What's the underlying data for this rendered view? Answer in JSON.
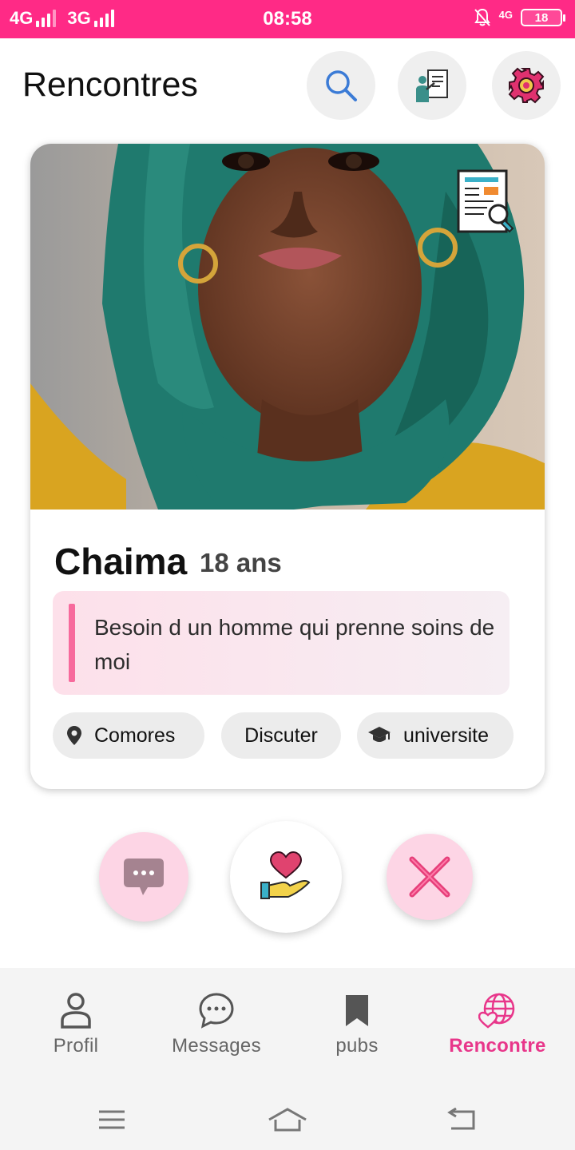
{
  "status_bar": {
    "network1": "4G",
    "network2": "3G",
    "time": "08:58",
    "network3": "4G",
    "battery": "18"
  },
  "header": {
    "title": "Rencontres",
    "icons": [
      "search-icon",
      "teacher-board-icon",
      "settings-gear-icon"
    ]
  },
  "profile_card": {
    "name": "Chaima",
    "age": "18 ans",
    "bio": "Besoin d un homme qui prenne soins de moi",
    "chips": {
      "location": "Comores",
      "intent": "Discuter",
      "education": "universite"
    },
    "photo_icon": "document-search-icon"
  },
  "actions": {
    "message_icon": "chat-bubble-icon",
    "like_icon": "heart-hand-icon",
    "dismiss_icon": "close-x-icon"
  },
  "bottom_nav": {
    "items": [
      {
        "label": "Profil",
        "icon": "person-icon"
      },
      {
        "label": "Messages",
        "icon": "chat-icon"
      },
      {
        "label": "pubs",
        "icon": "bookmark-icon"
      },
      {
        "label": "Rencontre",
        "icon": "globe-heart-icon"
      }
    ],
    "active_index": 3
  },
  "colors": {
    "accent": "#ff2a86",
    "active_nav": "#e8368a",
    "bio_bar": "#f76a9c",
    "action_pink": "#fdd5e5"
  }
}
